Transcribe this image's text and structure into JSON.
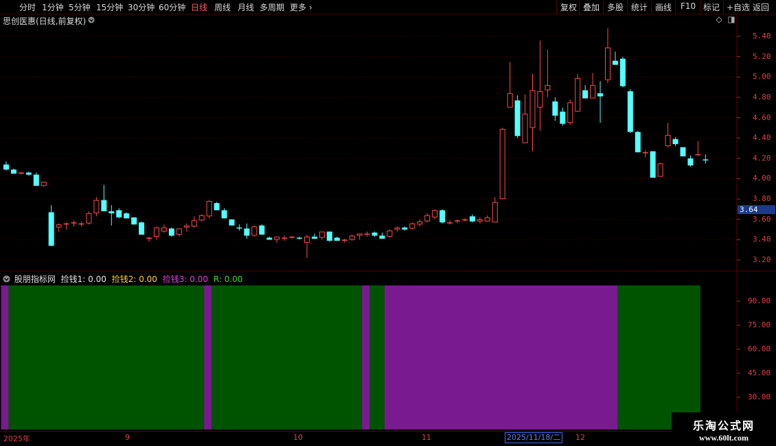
{
  "toolbar": {
    "periods": [
      "分时",
      "1分钟",
      "5分钟",
      "15分钟",
      "30分钟",
      "60分钟",
      "日线",
      "周线",
      "月线",
      "多周期",
      "更多"
    ],
    "active_period": "日线",
    "right_buttons": [
      "复权",
      "叠加",
      "多股",
      "统计",
      "画线",
      "F10",
      "+自选",
      "返回"
    ]
  },
  "main_chart": {
    "title": "思创医惠(日线,前复权)",
    "price_axis": [
      "5.40",
      "5.20",
      "5.00",
      "4.80",
      "4.60",
      "4.40",
      "4.20",
      "4.00",
      "3.80",
      "3.60",
      "3.40",
      "3.20"
    ],
    "current_price": "3.64"
  },
  "indicator": {
    "name": "股朋指标网",
    "labels": [
      {
        "text": "捡钱1: 0.00",
        "color": "#e8e8e8"
      },
      {
        "text": "捡钱2: 0.00",
        "color": "#ffd23a"
      },
      {
        "text": "捡钱3: 0.00",
        "color": "#e040e0"
      },
      {
        "text": "R: 0.00",
        "color": "#33dd33"
      }
    ],
    "axis": [
      "90.00",
      "75.00",
      "60.00",
      "45.00",
      "30.00"
    ]
  },
  "date_axis": {
    "labels": [
      "2025年",
      "9",
      "10",
      "11",
      "12"
    ],
    "cursor_date": "2025/11/18/二"
  },
  "watermark": {
    "title": "乐淘公式网",
    "url": "www.60lt.com"
  },
  "colors": {
    "up": "#ff4a4a",
    "down": "#54ffff",
    "green_band": "#005400",
    "purple_band": "#7a1a90",
    "grid": "#5a0000"
  },
  "chart_data": {
    "type": "candlestick",
    "title": "思创医惠(日线,前复权)",
    "ylim": [
      3.14,
      5.55
    ],
    "candles": [
      [
        4.14,
        4.17,
        4.08,
        4.09
      ],
      [
        4.09,
        4.1,
        4.05,
        4.05
      ],
      [
        4.05,
        4.07,
        4.04,
        4.06
      ],
      [
        4.06,
        4.07,
        4.03,
        4.04
      ],
      [
        4.04,
        4.06,
        3.93,
        3.93
      ],
      [
        3.93,
        3.97,
        3.92,
        3.97
      ],
      [
        3.67,
        3.74,
        3.34,
        3.34
      ],
      [
        3.52,
        3.56,
        3.48,
        3.55
      ],
      [
        3.55,
        3.57,
        3.5,
        3.56
      ],
      [
        3.57,
        3.59,
        3.53,
        3.57
      ],
      [
        3.55,
        3.58,
        3.53,
        3.56
      ],
      [
        3.56,
        3.68,
        3.55,
        3.66
      ],
      [
        3.66,
        3.82,
        3.63,
        3.79
      ],
      [
        3.79,
        3.94,
        3.68,
        3.68
      ],
      [
        3.68,
        3.74,
        3.54,
        3.66
      ],
      [
        3.69,
        3.71,
        3.61,
        3.62
      ],
      [
        3.66,
        3.67,
        3.61,
        3.61
      ],
      [
        3.62,
        3.62,
        3.55,
        3.55
      ],
      [
        3.57,
        3.58,
        3.45,
        3.45
      ],
      [
        3.42,
        3.43,
        3.38,
        3.42
      ],
      [
        3.43,
        3.53,
        3.4,
        3.52
      ],
      [
        3.48,
        3.55,
        3.47,
        3.52
      ],
      [
        3.51,
        3.52,
        3.43,
        3.44
      ],
      [
        3.45,
        3.51,
        3.43,
        3.51
      ],
      [
        3.52,
        3.56,
        3.48,
        3.54
      ],
      [
        3.53,
        3.63,
        3.52,
        3.59
      ],
      [
        3.59,
        3.65,
        3.58,
        3.64
      ],
      [
        3.63,
        3.79,
        3.61,
        3.78
      ],
      [
        3.76,
        3.77,
        3.69,
        3.69
      ],
      [
        3.69,
        3.71,
        3.61,
        3.61
      ],
      [
        3.6,
        3.6,
        3.54,
        3.54
      ],
      [
        3.52,
        3.55,
        3.49,
        3.51
      ],
      [
        3.51,
        3.56,
        3.41,
        3.44
      ],
      [
        3.44,
        3.54,
        3.43,
        3.53
      ],
      [
        3.54,
        3.55,
        3.45,
        3.45
      ],
      [
        3.42,
        3.43,
        3.4,
        3.4
      ],
      [
        3.4,
        3.43,
        3.37,
        3.43
      ],
      [
        3.42,
        3.44,
        3.39,
        3.42
      ],
      [
        3.42,
        3.44,
        3.41,
        3.43
      ],
      [
        3.42,
        3.43,
        3.4,
        3.41
      ],
      [
        3.37,
        3.45,
        3.22,
        3.43
      ],
      [
        3.43,
        3.46,
        3.41,
        3.41
      ],
      [
        3.42,
        3.48,
        3.4,
        3.48
      ],
      [
        3.48,
        3.48,
        3.38,
        3.39
      ],
      [
        3.42,
        3.43,
        3.39,
        3.39
      ],
      [
        3.39,
        3.41,
        3.37,
        3.4
      ],
      [
        3.4,
        3.45,
        3.39,
        3.44
      ],
      [
        3.44,
        3.46,
        3.4,
        3.46
      ],
      [
        3.45,
        3.48,
        3.43,
        3.46
      ],
      [
        3.47,
        3.48,
        3.43,
        3.44
      ],
      [
        3.44,
        3.47,
        3.41,
        3.41
      ],
      [
        3.43,
        3.5,
        3.42,
        3.49
      ],
      [
        3.5,
        3.53,
        3.48,
        3.52
      ],
      [
        3.52,
        3.53,
        3.49,
        3.5
      ],
      [
        3.51,
        3.57,
        3.5,
        3.56
      ],
      [
        3.55,
        3.6,
        3.53,
        3.58
      ],
      [
        3.58,
        3.66,
        3.57,
        3.64
      ],
      [
        3.62,
        3.7,
        3.6,
        3.69
      ],
      [
        3.69,
        3.7,
        3.56,
        3.57
      ],
      [
        3.57,
        3.59,
        3.55,
        3.57
      ],
      [
        3.58,
        3.6,
        3.56,
        3.59
      ],
      [
        3.6,
        3.61,
        3.58,
        3.6
      ],
      [
        3.63,
        3.65,
        3.57,
        3.58
      ],
      [
        3.58,
        3.62,
        3.56,
        3.6
      ],
      [
        3.58,
        3.64,
        3.58,
        3.62
      ],
      [
        3.57,
        3.82,
        3.57,
        3.77
      ],
      [
        3.8,
        4.5,
        3.8,
        4.49
      ],
      [
        4.7,
        5.15,
        4.7,
        4.84
      ],
      [
        4.77,
        4.82,
        4.4,
        4.42
      ],
      [
        4.35,
        4.83,
        4.35,
        4.64
      ],
      [
        4.5,
        5.03,
        4.27,
        4.87
      ],
      [
        4.7,
        5.36,
        4.47,
        4.86
      ],
      [
        4.87,
        5.27,
        4.8,
        4.92
      ],
      [
        4.76,
        4.8,
        4.57,
        4.62
      ],
      [
        4.66,
        4.7,
        4.52,
        4.54
      ],
      [
        4.55,
        4.78,
        4.53,
        4.75
      ],
      [
        4.66,
        5.03,
        4.66,
        4.99
      ],
      [
        4.87,
        4.92,
        4.79,
        4.79
      ],
      [
        4.79,
        5.04,
        4.79,
        4.92
      ],
      [
        4.84,
        4.96,
        4.55,
        4.81
      ],
      [
        4.97,
        5.48,
        4.94,
        5.29
      ],
      [
        5.16,
        5.25,
        5.12,
        5.12
      ],
      [
        5.18,
        5.2,
        4.9,
        4.91
      ],
      [
        4.86,
        4.88,
        4.45,
        4.46
      ],
      [
        4.46,
        4.47,
        4.26,
        4.26
      ],
      [
        4.25,
        4.28,
        4.21,
        4.26
      ],
      [
        4.27,
        4.27,
        4.01,
        4.01
      ],
      [
        4.02,
        4.16,
        4.02,
        4.15
      ],
      [
        4.32,
        4.55,
        4.31,
        4.43
      ],
      [
        4.39,
        4.41,
        4.32,
        4.34
      ],
      [
        4.31,
        4.31,
        4.22,
        4.22
      ],
      [
        4.2,
        4.23,
        4.12,
        4.13
      ],
      [
        4.24,
        4.37,
        4.23,
        4.24
      ],
      [
        4.19,
        4.24,
        4.15,
        4.18
      ]
    ],
    "indicator_bands": [
      {
        "from": 0,
        "to": 1,
        "color": "purple"
      },
      {
        "from": 1,
        "to": 27,
        "color": "green"
      },
      {
        "from": 27,
        "to": 28,
        "color": "purple"
      },
      {
        "from": 28,
        "to": 48,
        "color": "green"
      },
      {
        "from": 48,
        "to": 49,
        "color": "purple"
      },
      {
        "from": 49,
        "to": 51,
        "color": "green"
      },
      {
        "from": 51,
        "to": 82,
        "color": "purple"
      },
      {
        "from": 82,
        "to": 93,
        "color": "green"
      }
    ]
  }
}
